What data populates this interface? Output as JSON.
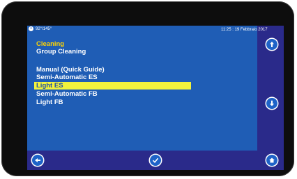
{
  "status": {
    "temps": "92°/145°",
    "datetime": "11:25 : 19 Febbraio 2017"
  },
  "menu": {
    "title": "Cleaning",
    "items": [
      "Group Cleaning",
      "Manual (Quick Guide)",
      "Semi-Automatic ES",
      "Light ES",
      "Semi-Automatic FB",
      "Light FB"
    ],
    "selected_index": 3
  },
  "icons": {
    "scroll_up": "arrow-up-icon",
    "scroll_down": "arrow-down-icon",
    "back": "back-icon",
    "confirm": "check-icon",
    "home": "home-icon"
  },
  "colors": {
    "screen_bg": "#1f5db5",
    "side_panel": "#2a2a8a",
    "title": "#ffd400",
    "selection": "#f2f23c"
  }
}
